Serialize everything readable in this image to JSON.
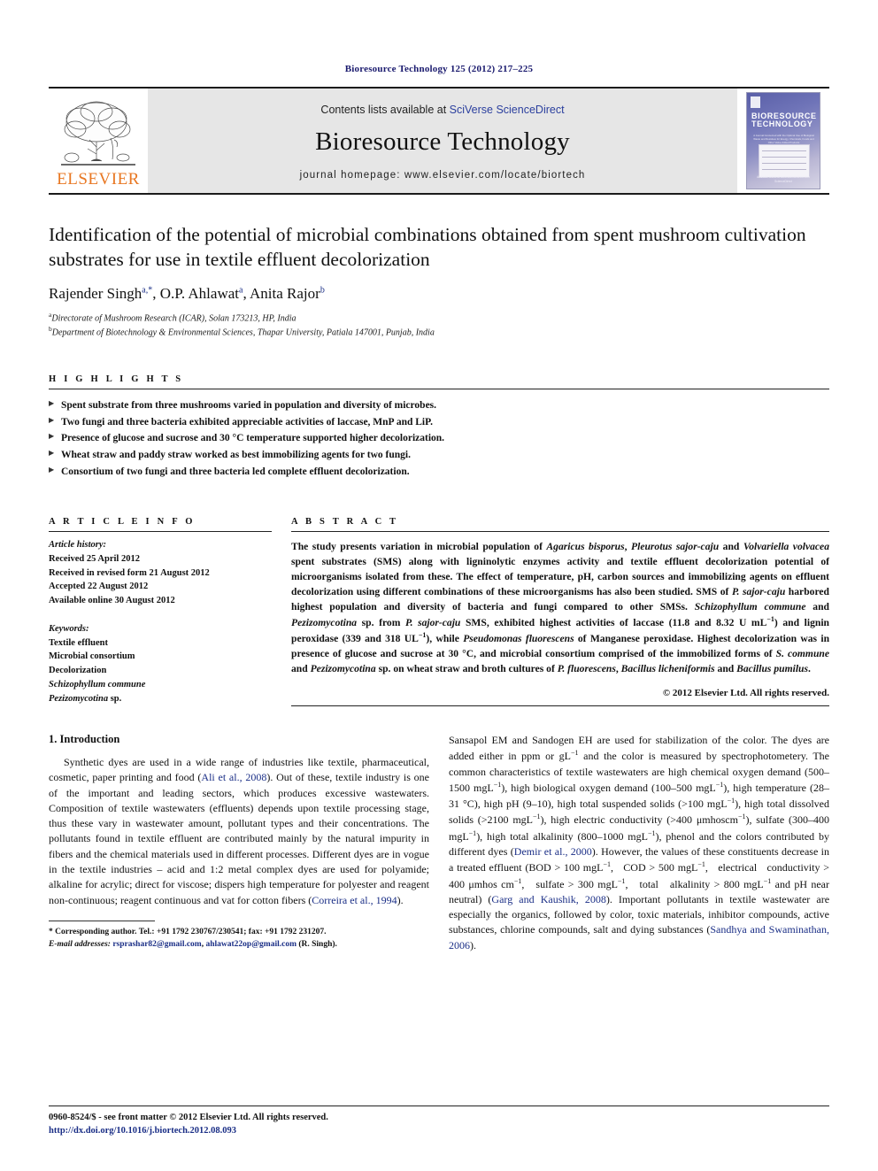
{
  "running_head": "Bioresource Technology 125 (2012) 217–225",
  "masthead": {
    "publisher_name": "ELSEVIER",
    "contents_prefix": "Contents lists available at ",
    "contents_link": "SciVerse ScienceDirect",
    "journal_title": "Bioresource Technology",
    "homepage": "journal homepage: www.elsevier.com/locate/biortech",
    "cover": {
      "line1": "BIORESOURCE",
      "line2": "TECHNOLOGY",
      "sub": "A Journal Concerned with the Optimal Use of Biological Waste and Residues for Energy, Chemicals, Foods and Other Value-Added Products",
      "foot1": "Available online at www.sciencedirect.com",
      "foot2": "ScienceDirect"
    }
  },
  "article": {
    "title": "Identification of the potential of microbial combinations obtained from spent mushroom cultivation substrates for use in textile effluent decolorization",
    "authors": "Rajender Singh",
    "authors_full": "Rajender Singh a,*, O.P. Ahlawat a, Anita Rajor b",
    "author_parts": {
      "a1": "Rajender Singh",
      "a1_sup": "a,*",
      "a2": ", O.P. Ahlawat",
      "a2_sup": "a",
      "a3": ", Anita Rajor",
      "a3_sup": "b"
    },
    "affiliations": [
      {
        "sup": "a",
        "text": "Directorate of Mushroom Research (ICAR), Solan 173213, HP, India"
      },
      {
        "sup": "b",
        "text": "Department of Biotechnology & Environmental Sciences, Thapar University, Patiala 147001, Punjab, India"
      }
    ]
  },
  "highlights": {
    "heading": "H I G H L I G H T S",
    "items": [
      "Spent substrate from three mushrooms varied in population and diversity of microbes.",
      "Two fungi and three bacteria exhibited appreciable activities of laccase, MnP and LiP.",
      "Presence of glucose and sucrose and 30 °C temperature supported higher decolorization.",
      "Wheat straw and paddy straw worked as best immobilizing agents for two fungi.",
      "Consortium of two fungi and three bacteria led complete effluent decolorization."
    ]
  },
  "article_info": {
    "heading": "A R T I C L E    I N F O",
    "history_label": "Article history:",
    "history": [
      "Received 25 April 2012",
      "Received in revised form 21 August 2012",
      "Accepted 22 August 2012",
      "Available online 30 August 2012"
    ],
    "keywords_label": "Keywords:",
    "keywords": [
      "Textile effluent",
      "Microbial consortium",
      "Decolorization",
      "Schizophyllum commune",
      "Pezizomycotina sp."
    ]
  },
  "abstract": {
    "heading": "A B S T R A C T",
    "text": "The study presents variation in microbial population of Agaricus bisporus, Pleurotus sajor-caju and Volvariella volvacea spent substrates (SMS) along with ligninolytic enzymes activity and textile effluent decolorization potential of microorganisms isolated from these. The effect of temperature, pH, carbon sources and immobilizing agents on effluent decolorization using different combinations of these microorganisms has also been studied. SMS of P. sajor-caju harbored highest population and diversity of bacteria and fungi compared to other SMSs. Schizophyllum commune and Pezizomycotina sp. from P. sajor-caju SMS, exhibited highest activities of laccase (11.8 and 8.32 U mL−1) and lignin peroxidase (339 and 318 UL−1), while Pseudomonas fluorescens of Manganese peroxidase. Highest decolorization was in presence of glucose and sucrose at 30 °C, and microbial consortium comprised of the immobilized forms of S. commune and Pezizomycotina sp. on wheat straw and broth cultures of P. fluorescens, Bacillus licheniformis and Bacillus pumilus.",
    "copyright": "© 2012 Elsevier Ltd. All rights reserved."
  },
  "body": {
    "section_heading": "1. Introduction",
    "left_paragraph": "Synthetic dyes are used in a wide range of industries like textile, pharmaceutical, cosmetic, paper printing and food (Ali et al., 2008). Out of these, textile industry is one of the important and leading sectors, which produces excessive wastewaters. Composition of textile wastewaters (effluents) depends upon textile processing stage, thus these vary in wastewater amount, pollutant types and their concentrations. The pollutants found in textile effluent are contributed mainly by the natural impurity in fibers and the chemical materials used in different processes. Different dyes are in vogue in the textile industries – acid and 1:2 metal complex dyes are used for polyamide; alkaline for acrylic; direct for viscose; dispers high temperature for polyester and reagent non-continuous; reagent continuous and vat for cotton fibers (Correira et al., 1994).",
    "left_citations": [
      "Ali et al., 2008",
      "Correira et al., 1994"
    ],
    "right_paragraph": "Sansapol EM and Sandogen EH are used for stabilization of the color. The dyes are added either in ppm or gL−1 and the color is measured by spectrophotometery. The common characteristics of textile wastewaters are high chemical oxygen demand (500–1500 mgL−1), high biological oxygen demand (100–500 mgL−1), high temperature (28–31 °C), high pH (9–10), high total suspended solids (>100 mgL−1), high total dissolved solids (>2100 mgL−1), high electric conductivity (>400 μmhoscm−1), sulfate (300–400 mgL−1), high total alkalinity (800–1000 mgL−1), phenol and the colors contributed by different dyes (Demir et al., 2000). However, the values of these constituents decrease in a treated effluent (BOD > 100 mgL−1, COD > 500 mgL−1, electrical conductivity > 400 μmhos cm−1, sulfate > 300 mgL−1, total alkalinity > 800 mgL−1 and pH near neutral) (Garg and Kaushik, 2008). Important pollutants in textile wastewater are especially the organics, followed by color, toxic materials, inhibitor compounds, active substances, chlorine compounds, salt and dying substances (Sandhya and Swaminathan, 2006).",
    "right_citations": [
      "Demir et al., 2000",
      "Garg and Kaushik, 2008",
      "Sandhya and Swaminathan, 2006"
    ]
  },
  "footnote": {
    "marker": "*",
    "corresponding": "Corresponding author. Tel.: +91 1792 230767/230541; fax: +91 1792 231207.",
    "email_label": "E-mail addresses:",
    "email1": "rsprashar82@gmail.com",
    "email2": "ahlawat22op@gmail.com",
    "email_suffix": "(R. Singh)."
  },
  "page_footer": {
    "issn_line": "0960-8524/$ - see front matter © 2012 Elsevier Ltd. All rights reserved.",
    "doi": "http://dx.doi.org/10.1016/j.biortech.2012.08.093"
  },
  "colors": {
    "link": "#1a2e86",
    "elsevier_orange": "#e87722",
    "running_head": "#1a1a6e",
    "masthead_bg": "#e6e6e6"
  }
}
